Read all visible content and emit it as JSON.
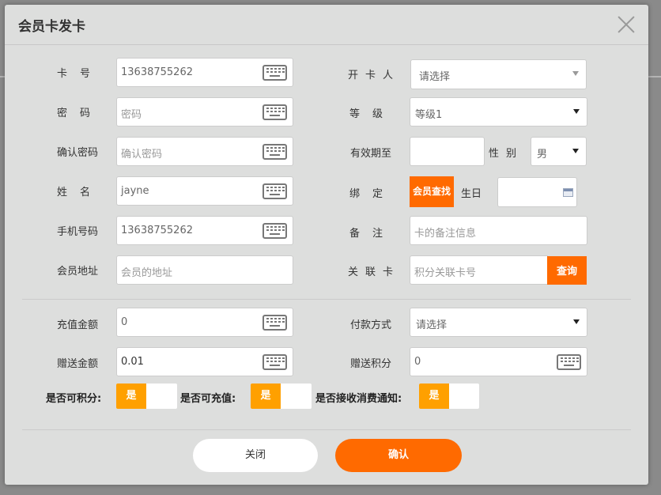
{
  "dialog": {
    "title": "会员卡发卡"
  },
  "left_fields": [
    {
      "label": "卡号",
      "value": "13638755262",
      "placeholder": ""
    },
    {
      "label": "密码",
      "value": "",
      "placeholder": "密码"
    },
    {
      "label": "确认密码",
      "value": "",
      "placeholder": "确认密码"
    },
    {
      "label": "姓名",
      "value": "jayne",
      "placeholder": ""
    },
    {
      "label": "手机号码",
      "value": "13638755262",
      "placeholder": ""
    },
    {
      "label": "会员地址",
      "value": "",
      "placeholder": "会员的地址"
    }
  ],
  "right_fields": {
    "opener": {
      "label": "开卡人",
      "value": "请选择"
    },
    "level": {
      "label": "等级",
      "value": "等级1"
    },
    "expiry": {
      "label": "有效期至",
      "value": ""
    },
    "gender": {
      "label": "性别",
      "value": "男"
    },
    "bind": {
      "label": "绑定",
      "button": "会员查找"
    },
    "birthday": {
      "label": "生日",
      "value": ""
    },
    "remark": {
      "label": "备注",
      "placeholder": "卡的备注信息"
    },
    "linked_card": {
      "label": "关联卡",
      "placeholder": "积分关联卡号",
      "button": "查询"
    }
  },
  "payment": {
    "recharge": {
      "label": "充值金额",
      "value": "0"
    },
    "method": {
      "label": "付款方式",
      "value": "请选择"
    },
    "gift_amount": {
      "label": "赠送金额",
      "value": "0.01"
    },
    "gift_points": {
      "label": "赠送积分",
      "value": "0"
    }
  },
  "toggles": [
    {
      "label": "是否可积分:",
      "value": "是"
    },
    {
      "label": "是否可充值:",
      "value": "是"
    },
    {
      "label": "是否接收消费通知:",
      "value": "是"
    }
  ],
  "actions": {
    "close": "关闭",
    "confirm": "确认"
  },
  "colors": {
    "accent": "#ff6a00",
    "toggle_on": "#ffa000"
  }
}
